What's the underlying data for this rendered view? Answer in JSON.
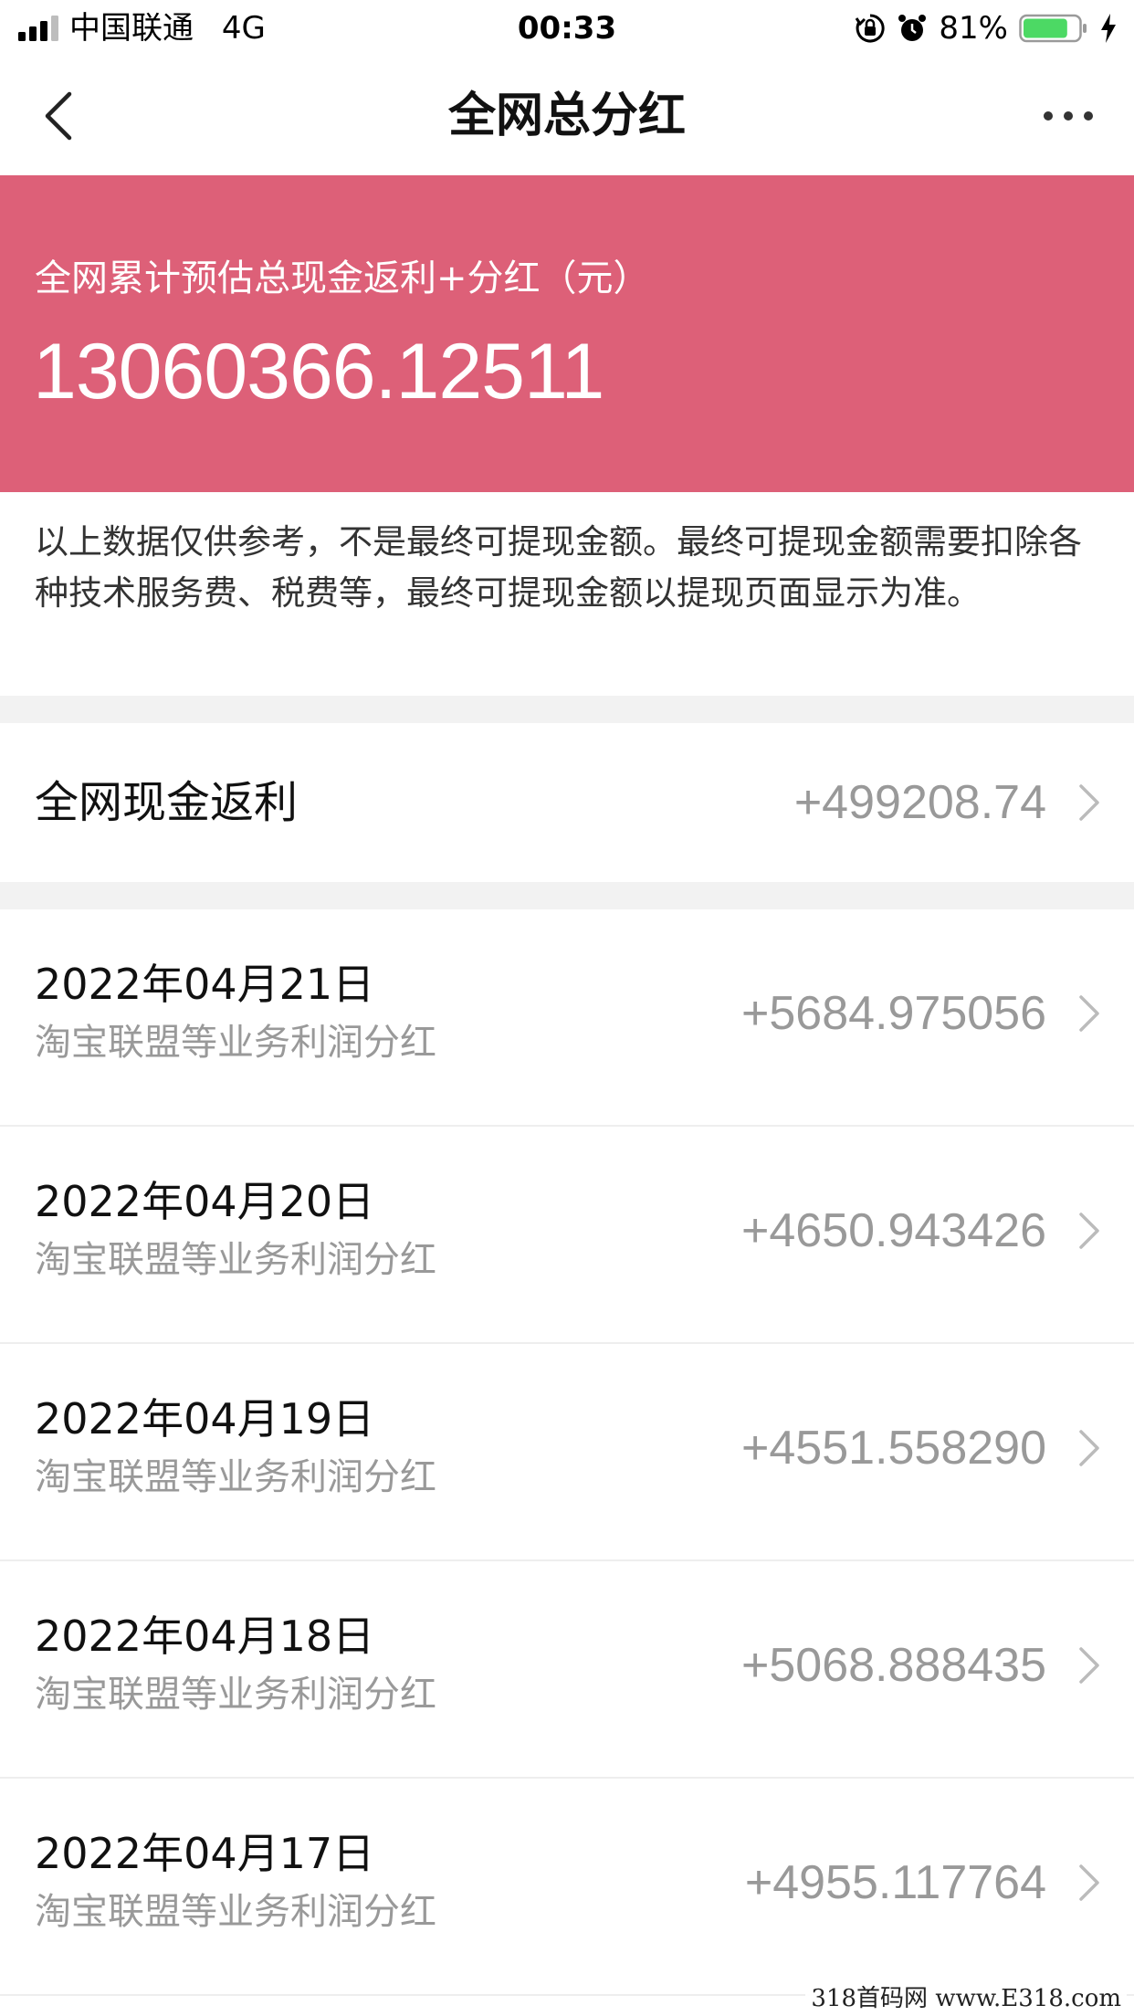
{
  "status_bar": {
    "carrier": "中国联通",
    "network": "4G",
    "time": "00:33",
    "battery": "81%",
    "battery_level": 0.81
  },
  "nav": {
    "title": "全网总分红"
  },
  "hero": {
    "label": "全网累计预估总现金返利+分红（元）",
    "value": "13060366.12511",
    "color": "#dd6078"
  },
  "disclaimer": "以上数据仅供参考，不是最终可提现金额。最终可提现金额需要扣除各种技术服务费、税费等，最终可提现金额以提现页面显示为准。",
  "cash_rebate": {
    "label": "全网现金返利",
    "amount": "+499208.74"
  },
  "dividends": [
    {
      "date": "2022年04月21日",
      "desc": "淘宝联盟等业务利润分红",
      "amount": "+5684.975056"
    },
    {
      "date": "2022年04月20日",
      "desc": "淘宝联盟等业务利润分红",
      "amount": "+4650.943426"
    },
    {
      "date": "2022年04月19日",
      "desc": "淘宝联盟等业务利润分红",
      "amount": "+4551.558290"
    },
    {
      "date": "2022年04月18日",
      "desc": "淘宝联盟等业务利润分红",
      "amount": "+5068.888435"
    },
    {
      "date": "2022年04月17日",
      "desc": "淘宝联盟等业务利润分红",
      "amount": "+4955.117764"
    }
  ],
  "watermark": "318首码网 www.E318.com"
}
